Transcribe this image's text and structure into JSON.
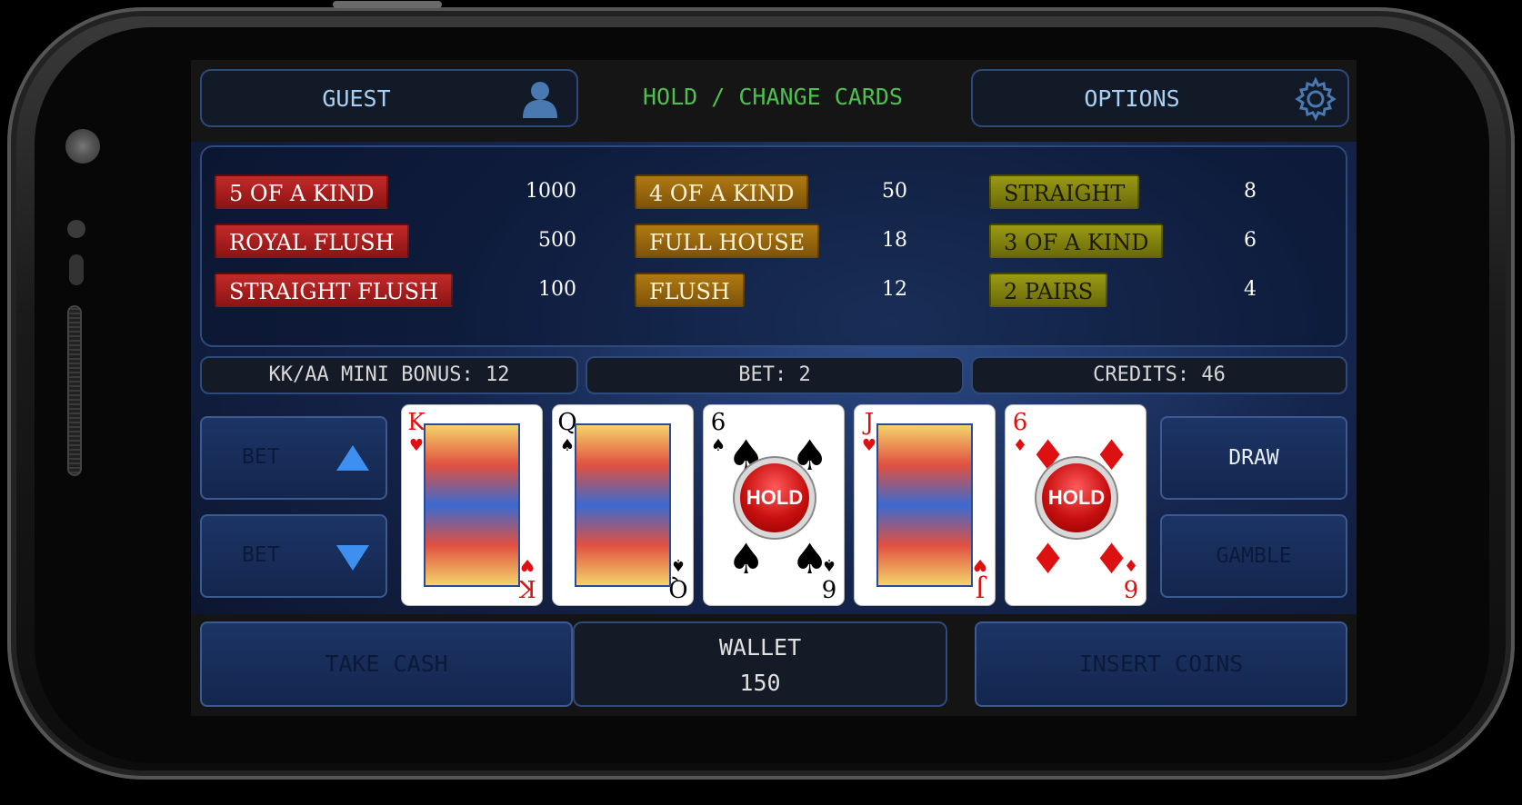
{
  "header": {
    "player_label": "GUEST",
    "mode_label": "HOLD / CHANGE CARDS",
    "options_label": "OPTIONS",
    "player_icon": "user-icon",
    "options_icon": "gear-icon"
  },
  "paytable": {
    "columns": [
      [
        {
          "hand": "5 OF A KIND",
          "payout": "1000"
        },
        {
          "hand": "ROYAL FLUSH",
          "payout": "500"
        },
        {
          "hand": "STRAIGHT FLUSH",
          "payout": "100"
        }
      ],
      [
        {
          "hand": "4 OF A KIND",
          "payout": "50"
        },
        {
          "hand": "FULL HOUSE",
          "payout": "18"
        },
        {
          "hand": "FLUSH",
          "payout": "12"
        }
      ],
      [
        {
          "hand": "STRAIGHT",
          "payout": "8"
        },
        {
          "hand": "3 OF A KIND",
          "payout": "6"
        },
        {
          "hand": "2 PAIRS",
          "payout": "4"
        }
      ]
    ]
  },
  "status": {
    "mini_bonus": "KK/AA  MINI BONUS: 12",
    "bet": "BET: 2",
    "credits": "CREDITS: 46"
  },
  "controls": {
    "bet_up_label": "BET",
    "bet_down_label": "BET",
    "draw_label": "DRAW",
    "gamble_label": "GAMBLE",
    "hold_label": "HOLD"
  },
  "cards": [
    {
      "rank": "K",
      "suit": "♥",
      "color": "#d11",
      "held": false
    },
    {
      "rank": "Q",
      "suit": "♠",
      "color": "#000",
      "held": false
    },
    {
      "rank": "6",
      "suit": "♠",
      "color": "#000",
      "held": true
    },
    {
      "rank": "J",
      "suit": "♥",
      "color": "#d11",
      "held": false
    },
    {
      "rank": "6",
      "suit": "♦",
      "color": "#d11",
      "held": true
    }
  ],
  "footer": {
    "take_cash_label": "TAKE CASH",
    "wallet_label": "WALLET",
    "wallet_value": "150",
    "insert_coins_label": "INSERT COINS"
  },
  "colors": {
    "mode_text": "#4fc04f",
    "button_text_active": "#a9d0f5",
    "paytable_red": "#b02020",
    "paytable_orange": "#9a6a10",
    "paytable_olive": "#8a8a10"
  }
}
